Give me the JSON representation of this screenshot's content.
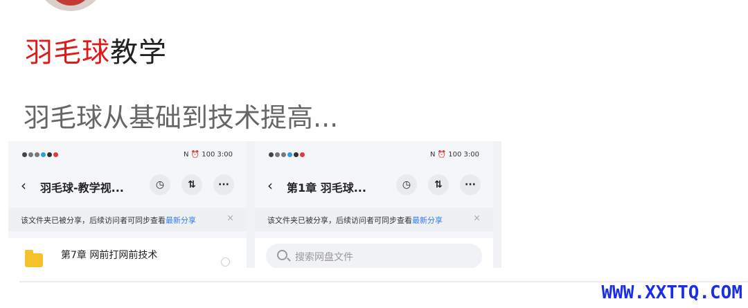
{
  "post": {
    "title_highlight": "羽毛球",
    "title_rest": "教学",
    "description": "羽毛球从基础到技术提高..."
  },
  "shot_left": {
    "status_right": "N ⏰ 100 3:00",
    "nav_title": "羽毛球-教学视...",
    "banner_text": "该文件夹已被分享，后续访问者可同步查看",
    "banner_link": "最新分享",
    "file_name": "第7章 网前打网前技术"
  },
  "shot_right": {
    "status_right": "N ⏰ 100 3:00",
    "nav_title": "第1章 羽毛球...",
    "banner_text": "该文件夹已被分享，后续访问者可同步查看",
    "banner_link": "最新分享",
    "search_placeholder": "搜索网盘文件"
  },
  "icons": {
    "back": "‹",
    "history": "◷",
    "sort": "⇅",
    "more": "···",
    "close": "×"
  },
  "watermark": "WWW.XXTTQ.COM",
  "colors": {
    "highlight": "#e21919",
    "link": "#2d7ff0",
    "folder": "#f6c12a",
    "watermark": "#1a2ee8"
  }
}
